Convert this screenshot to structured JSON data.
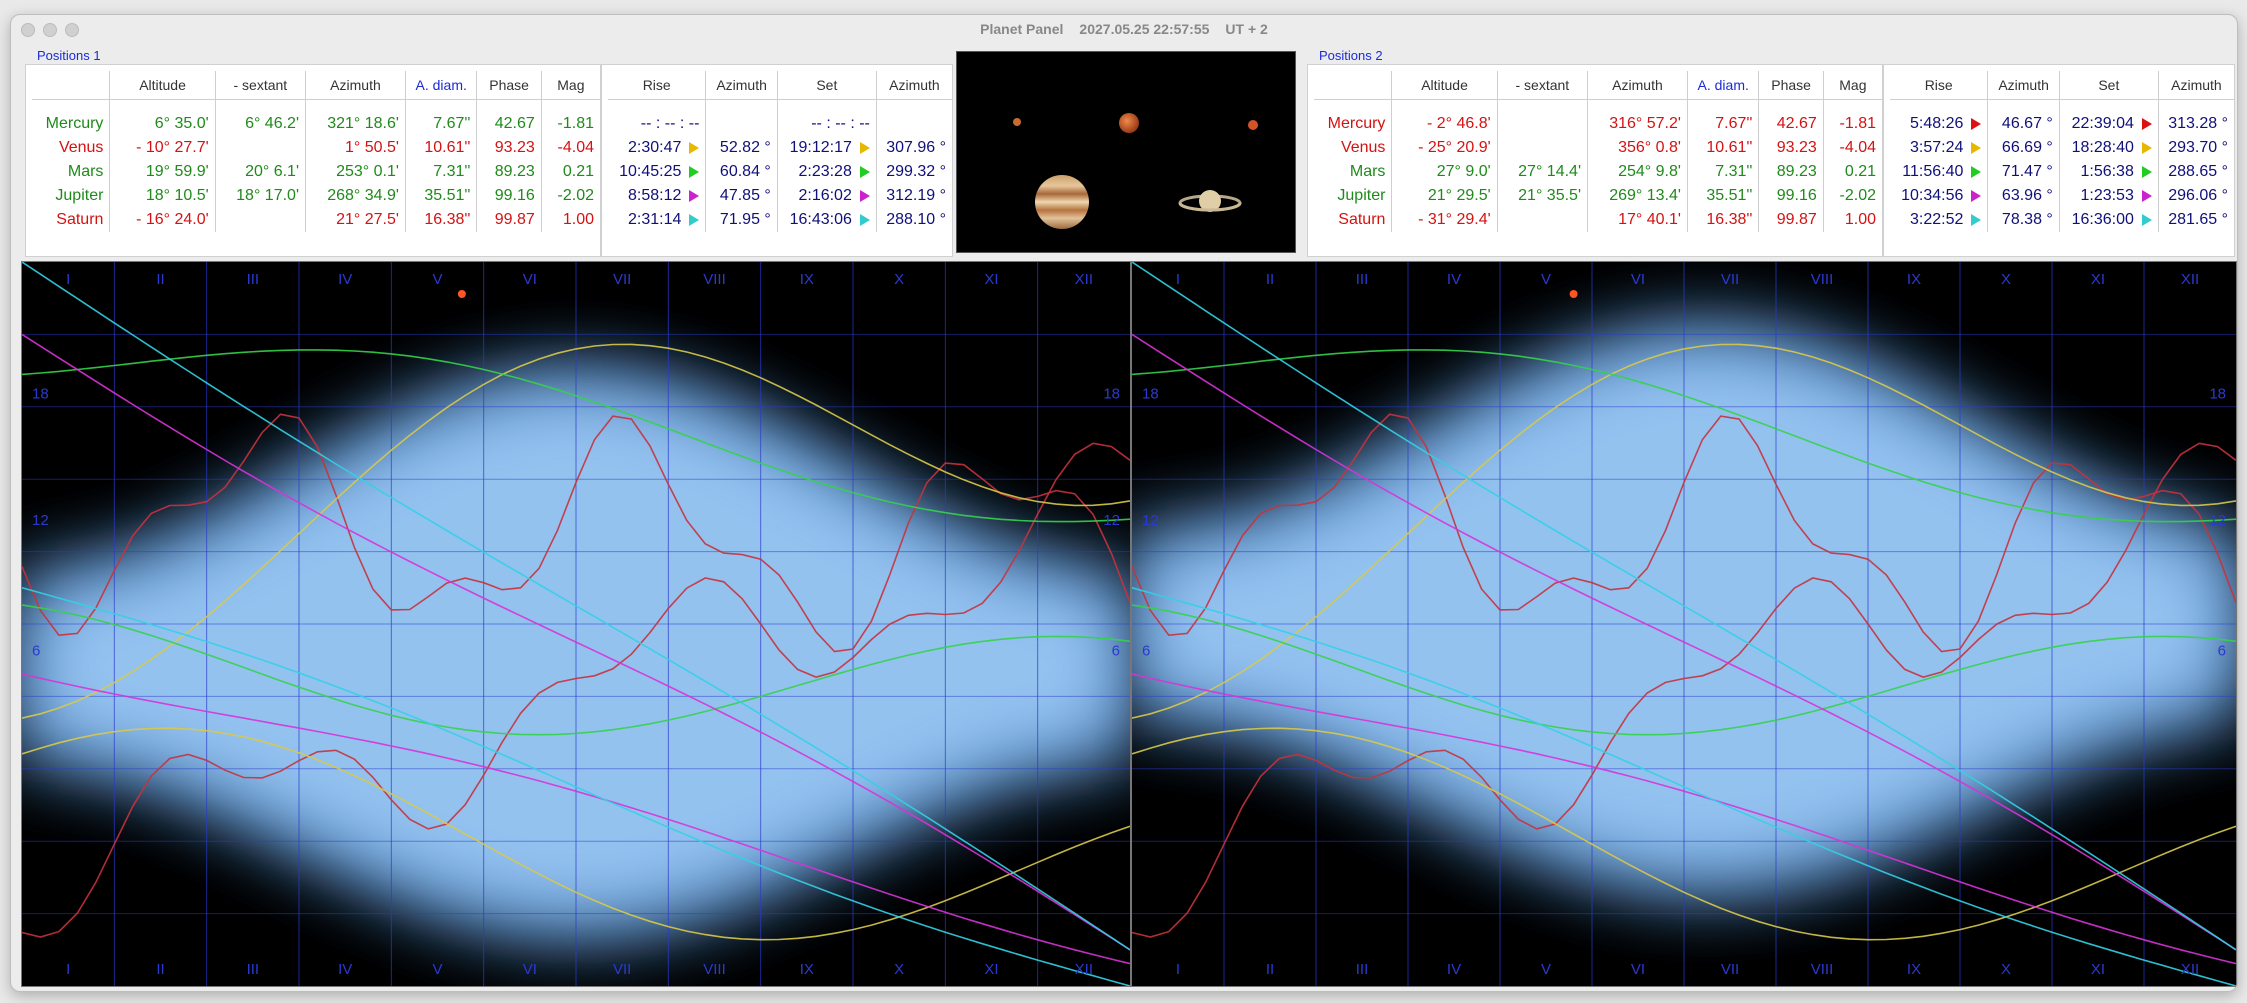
{
  "window": {
    "title": "Planet Panel",
    "datetime": "2027.05.25 22:57:55",
    "timezone": "UT + 2"
  },
  "positions1": {
    "label": "Positions 1",
    "headers": [
      "",
      "Altitude",
      "- sextant",
      "Azimuth",
      "A. diam.",
      "Phase",
      "Mag"
    ],
    "rows": [
      {
        "name": "Mercury",
        "altitude": "6° 35.0'",
        "sextant": "6° 46.2'",
        "azimuth": "321° 18.6'",
        "adiam": "7.67''",
        "phase": "42.67",
        "mag": "-1.81",
        "color": "green"
      },
      {
        "name": "Venus",
        "altitude": "- 10° 27.7'",
        "sextant": "",
        "azimuth": "1° 50.5'",
        "adiam": "10.61''",
        "phase": "93.23",
        "mag": "-4.04",
        "color": "red"
      },
      {
        "name": "Mars",
        "altitude": "19° 59.9'",
        "sextant": "20° 6.1'",
        "azimuth": "253° 0.1'",
        "adiam": "7.31''",
        "phase": "89.23",
        "mag": "0.21",
        "color": "green"
      },
      {
        "name": "Jupiter",
        "altitude": "18° 10.5'",
        "sextant": "18° 17.0'",
        "azimuth": "268° 34.9'",
        "adiam": "35.51''",
        "phase": "99.16",
        "mag": "-2.02",
        "color": "green"
      },
      {
        "name": "Saturn",
        "altitude": "- 16° 24.0'",
        "sextant": "",
        "azimuth": "21° 27.5'",
        "adiam": "16.38''",
        "phase": "99.87",
        "mag": "1.00",
        "color": "red"
      }
    ],
    "rise_headers": [
      "Rise",
      "Azimuth",
      "Set",
      "Azimuth"
    ],
    "rise_rows": [
      {
        "rise": "-- : -- : --",
        "rise_az": "",
        "set": "-- : -- : --",
        "set_az": "",
        "marker": ""
      },
      {
        "rise": "2:30:47",
        "rise_az": "52.82 °",
        "set": "19:12:17",
        "set_az": "307.96 °",
        "marker": "#e6b800"
      },
      {
        "rise": "10:45:25",
        "rise_az": "60.84 °",
        "set": "2:23:28",
        "set_az": "299.32 °",
        "marker": "#22cc22"
      },
      {
        "rise": "8:58:12",
        "rise_az": "47.85 °",
        "set": "2:16:02",
        "set_az": "312.19 °",
        "marker": "#cc22cc"
      },
      {
        "rise": "2:31:14",
        "rise_az": "71.95 °",
        "set": "16:43:06",
        "set_az": "288.10 °",
        "marker": "#33cccc"
      }
    ]
  },
  "positions2": {
    "label": "Positions 2",
    "headers": [
      "",
      "Altitude",
      "- sextant",
      "Azimuth",
      "A. diam.",
      "Phase",
      "Mag"
    ],
    "rows": [
      {
        "name": "Mercury",
        "altitude": "- 2° 46.8'",
        "sextant": "",
        "azimuth": "316° 57.2'",
        "adiam": "7.67''",
        "phase": "42.67",
        "mag": "-1.81",
        "color": "red"
      },
      {
        "name": "Venus",
        "altitude": "- 25° 20.9'",
        "sextant": "",
        "azimuth": "356° 0.8'",
        "adiam": "10.61''",
        "phase": "93.23",
        "mag": "-4.04",
        "color": "red"
      },
      {
        "name": "Mars",
        "altitude": "27° 9.0'",
        "sextant": "27° 14.4'",
        "azimuth": "254° 9.8'",
        "adiam": "7.31''",
        "phase": "89.23",
        "mag": "0.21",
        "color": "green"
      },
      {
        "name": "Jupiter",
        "altitude": "21° 29.5'",
        "sextant": "21° 35.5'",
        "azimuth": "269° 13.4'",
        "adiam": "35.51''",
        "phase": "99.16",
        "mag": "-2.02",
        "color": "green"
      },
      {
        "name": "Saturn",
        "altitude": "- 31° 29.4'",
        "sextant": "",
        "azimuth": "17° 40.1'",
        "adiam": "16.38''",
        "phase": "99.87",
        "mag": "1.00",
        "color": "red"
      }
    ],
    "rise_headers": [
      "Rise",
      "Azimuth",
      "Set",
      "Azimuth"
    ],
    "rise_rows": [
      {
        "rise": "5:48:26",
        "rise_az": "46.67 °",
        "set": "22:39:04",
        "set_az": "313.28 °",
        "marker": "#dd1111"
      },
      {
        "rise": "3:57:24",
        "rise_az": "66.69 °",
        "set": "18:28:40",
        "set_az": "293.70 °",
        "marker": "#e6b800"
      },
      {
        "rise": "11:56:40",
        "rise_az": "71.47 °",
        "set": "1:56:38",
        "set_az": "288.65 °",
        "marker": "#22cc22"
      },
      {
        "rise": "10:34:56",
        "rise_az": "63.96 °",
        "set": "1:23:53",
        "set_az": "296.06 °",
        "marker": "#cc22cc"
      },
      {
        "rise": "3:22:52",
        "rise_az": "78.38 °",
        "set": "16:36:00",
        "set_az": "281.65 °",
        "marker": "#33cccc"
      }
    ]
  },
  "charts": {
    "months": [
      "I",
      "II",
      "III",
      "IV",
      "V",
      "VI",
      "VII",
      "VIII",
      "IX",
      "X",
      "XI",
      "XII"
    ],
    "hours": [
      "18",
      "12",
      "6"
    ],
    "series_colors": {
      "mercury": "#c8323c",
      "venus": "#d8c94a",
      "mars": "#34d34a",
      "jupiter": "#d833d8",
      "saturn": "#33d0e6",
      "sun": "#ff5522"
    }
  }
}
